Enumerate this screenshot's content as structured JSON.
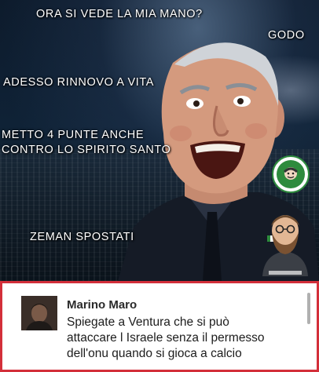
{
  "meme": {
    "captions": [
      "ORA SI VEDE LA MIA MANO?",
      "GODO",
      "ADESSO RINNOVO A VITA",
      "METTO 4 PUNTE ANCHE",
      "CONTRO LO SPIRITO SANTO",
      "ZEMAN SPOSTATI"
    ]
  },
  "comment": {
    "author": "Marino Maro",
    "lines": [
      "Spiegate a Ventura che si può",
      "attaccare l Israele senza il permesso",
      "dell'onu quando si gioca a calcio"
    ]
  }
}
